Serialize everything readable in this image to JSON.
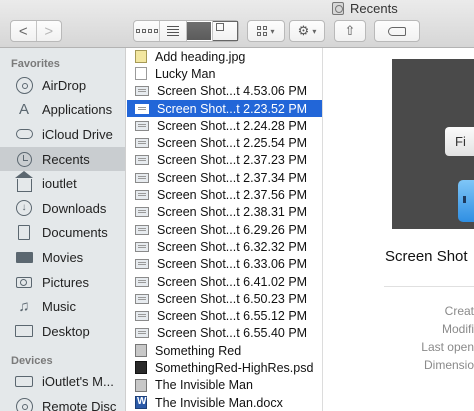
{
  "window": {
    "title": "Recents"
  },
  "toolbar": {
    "back_label": "<",
    "forward_label": ">",
    "action_caret": "▾",
    "arrange_caret": "▾"
  },
  "sidebar": {
    "favorites_header": "Favorites",
    "devices_header": "Devices",
    "favorites": [
      {
        "label": "AirDrop",
        "icon": "airdrop-icon"
      },
      {
        "label": "Applications",
        "icon": "applications-icon"
      },
      {
        "label": "iCloud Drive",
        "icon": "icloud-icon"
      },
      {
        "label": "Recents",
        "icon": "recents-clock-icon",
        "selected": true
      },
      {
        "label": "ioutlet",
        "icon": "home-icon"
      },
      {
        "label": "Downloads",
        "icon": "downloads-icon"
      },
      {
        "label": "Documents",
        "icon": "documents-icon"
      },
      {
        "label": "Movies",
        "icon": "movies-icon"
      },
      {
        "label": "Pictures",
        "icon": "pictures-icon"
      },
      {
        "label": "Music",
        "icon": "music-icon"
      },
      {
        "label": "Desktop",
        "icon": "desktop-icon"
      }
    ],
    "devices": [
      {
        "label": "iOutlet's M...",
        "icon": "computer-icon"
      },
      {
        "label": "Remote Disc",
        "icon": "remote-disc-icon"
      }
    ]
  },
  "files": [
    {
      "name": "Add heading.jpg",
      "type": "jpg"
    },
    {
      "name": "Lucky Man",
      "type": "doc"
    },
    {
      "name": "Screen Shot...t 4.53.06 PM",
      "type": "shot"
    },
    {
      "name": "Screen Shot...t 2.23.52 PM",
      "type": "shot",
      "selected": true
    },
    {
      "name": "Screen Shot...t 2.24.28 PM",
      "type": "shot"
    },
    {
      "name": "Screen Shot...t 2.25.54 PM",
      "type": "shot"
    },
    {
      "name": "Screen Shot...t 2.37.23 PM",
      "type": "shot"
    },
    {
      "name": "Screen Shot...t 2.37.34 PM",
      "type": "shot"
    },
    {
      "name": "Screen Shot...t 2.37.56 PM",
      "type": "shot"
    },
    {
      "name": "Screen Shot...t 2.38.31 PM",
      "type": "shot"
    },
    {
      "name": "Screen Shot...t 6.29.26 PM",
      "type": "shot"
    },
    {
      "name": "Screen Shot...t 6.32.32 PM",
      "type": "shot"
    },
    {
      "name": "Screen Shot...t 6.33.06 PM",
      "type": "shot"
    },
    {
      "name": "Screen Shot...t 6.41.02 PM",
      "type": "shot"
    },
    {
      "name": "Screen Shot...t 6.50.23 PM",
      "type": "shot"
    },
    {
      "name": "Screen Shot...t 6.55.12 PM",
      "type": "shot"
    },
    {
      "name": "Screen Shot...t 6.55.40 PM",
      "type": "shot"
    },
    {
      "name": "Something Red",
      "type": "red"
    },
    {
      "name": "SomethingRed-HighRes.psd",
      "type": "psd"
    },
    {
      "name": "The Invisible Man",
      "type": "red"
    },
    {
      "name": "The Invisible Man.docx",
      "type": "word"
    }
  ],
  "preview": {
    "button_text": "Fi",
    "name": "Screen Shot",
    "meta": [
      "Creat",
      "Modifi",
      "Last open",
      "Dimensio"
    ]
  }
}
